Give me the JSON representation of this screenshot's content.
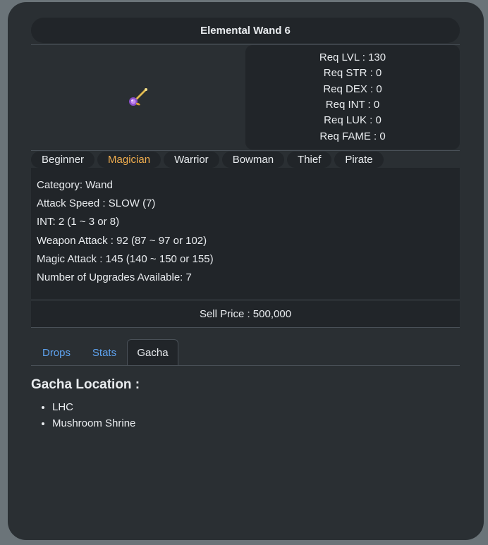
{
  "item": {
    "title": "Elemental Wand 6",
    "icon": "elemental-wand-icon"
  },
  "requirements": [
    "Req LVL : 130",
    "Req STR : 0",
    "Req DEX : 0",
    "Req INT : 0",
    "Req LUK : 0",
    "Req FAME : 0"
  ],
  "jobs": [
    {
      "label": "Beginner",
      "active": false
    },
    {
      "label": "Magician",
      "active": true
    },
    {
      "label": "Warrior",
      "active": false
    },
    {
      "label": "Bowman",
      "active": false
    },
    {
      "label": "Thief",
      "active": false
    },
    {
      "label": "Pirate",
      "active": false
    }
  ],
  "stats": [
    "Category: Wand",
    "Attack Speed : SLOW (7)",
    "INT: 2 (1 ~ 3 or 8)",
    "Weapon Attack : 92 (87 ~ 97 or 102)",
    "Magic Attack : 145 (140 ~ 150 or 155)",
    "Number of Upgrades Available: 7"
  ],
  "sell_price": "Sell Price : 500,000",
  "tabs": [
    {
      "label": "Drops",
      "active": false
    },
    {
      "label": "Stats",
      "active": false
    },
    {
      "label": "Gacha",
      "active": true
    }
  ],
  "gacha": {
    "heading": "Gacha Location :",
    "locations": [
      "LHC",
      "Mushroom Shrine"
    ]
  },
  "colors": {
    "active_job": "#f0ad4e",
    "tab_link": "#5ea3f0",
    "panel": "#212529"
  }
}
